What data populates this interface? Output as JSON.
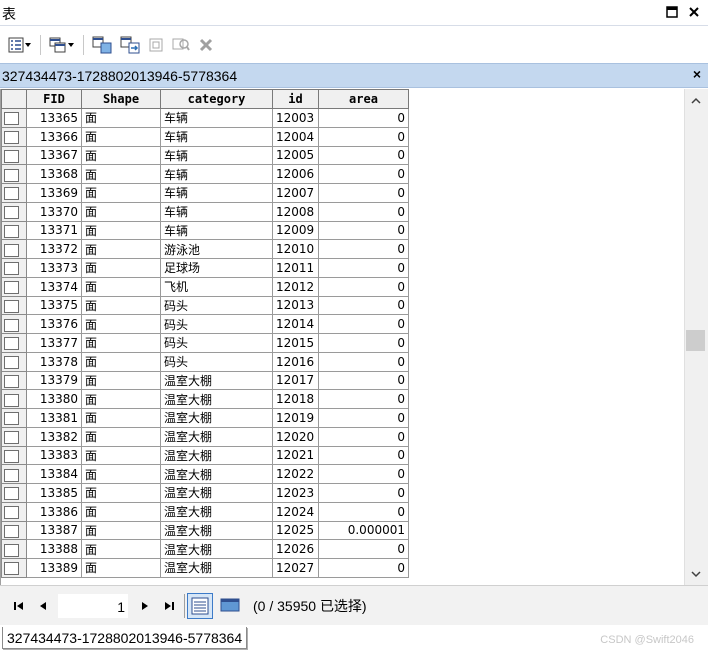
{
  "window": {
    "title": "表"
  },
  "tab": {
    "name": "327434473-1728802013946-5778364"
  },
  "table": {
    "columns": [
      "FID",
      "Shape",
      "category",
      "id",
      "area"
    ],
    "rows": [
      [
        "13365",
        "面",
        "车辆",
        "12003",
        "0"
      ],
      [
        "13366",
        "面",
        "车辆",
        "12004",
        "0"
      ],
      [
        "13367",
        "面",
        "车辆",
        "12005",
        "0"
      ],
      [
        "13368",
        "面",
        "车辆",
        "12006",
        "0"
      ],
      [
        "13369",
        "面",
        "车辆",
        "12007",
        "0"
      ],
      [
        "13370",
        "面",
        "车辆",
        "12008",
        "0"
      ],
      [
        "13371",
        "面",
        "车辆",
        "12009",
        "0"
      ],
      [
        "13372",
        "面",
        "游泳池",
        "12010",
        "0"
      ],
      [
        "13373",
        "面",
        "足球场",
        "12011",
        "0"
      ],
      [
        "13374",
        "面",
        "飞机",
        "12012",
        "0"
      ],
      [
        "13375",
        "面",
        "码头",
        "12013",
        "0"
      ],
      [
        "13376",
        "面",
        "码头",
        "12014",
        "0"
      ],
      [
        "13377",
        "面",
        "码头",
        "12015",
        "0"
      ],
      [
        "13378",
        "面",
        "码头",
        "12016",
        "0"
      ],
      [
        "13379",
        "面",
        "温室大棚",
        "12017",
        "0"
      ],
      [
        "13380",
        "面",
        "温室大棚",
        "12018",
        "0"
      ],
      [
        "13381",
        "面",
        "温室大棚",
        "12019",
        "0"
      ],
      [
        "13382",
        "面",
        "温室大棚",
        "12020",
        "0"
      ],
      [
        "13383",
        "面",
        "温室大棚",
        "12021",
        "0"
      ],
      [
        "13384",
        "面",
        "温室大棚",
        "12022",
        "0"
      ],
      [
        "13385",
        "面",
        "温室大棚",
        "12023",
        "0"
      ],
      [
        "13386",
        "面",
        "温室大棚",
        "12024",
        "0"
      ],
      [
        "13387",
        "面",
        "温室大棚",
        "12025",
        "0.000001"
      ],
      [
        "13388",
        "面",
        "温室大棚",
        "12026",
        "0"
      ],
      [
        "13389",
        "面",
        "温室大棚",
        "12027",
        "0"
      ]
    ]
  },
  "navigation": {
    "current_record": "1",
    "selection_status": "(0 / 35950 已选择)"
  },
  "bottom_tab": {
    "name": "327434473-1728802013946-5778364"
  },
  "watermark": "CSDN @Swift2046",
  "icons": {
    "table-options": "table-options-icon",
    "related-tables": "related-tables-icon",
    "select-by-attributes": "select-by-attributes-icon",
    "switch-selection": "switch-selection-icon",
    "clear-selection": "clear-selection-icon",
    "zoom-to-selected": "zoom-to-selected-icon",
    "delete-selected": "delete-icon"
  },
  "colors": {
    "tab_bar": "#c4d8ef",
    "active_view": "#3d7bc8"
  }
}
